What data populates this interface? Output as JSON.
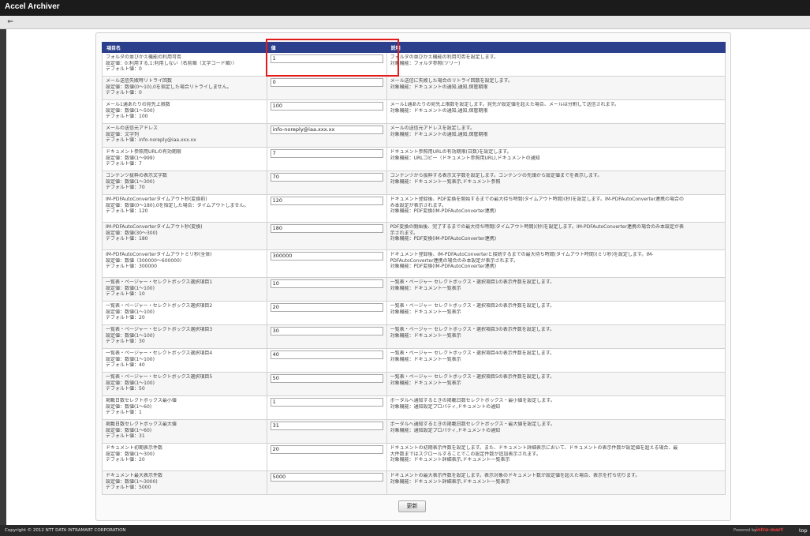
{
  "window": {
    "title": "Accel Archiver"
  },
  "toolbar": {
    "back_label": "⇐"
  },
  "table": {
    "headers": {
      "name": "項目名",
      "value": "値",
      "description": "説明"
    },
    "rows": [
      {
        "name": [
          "フォルダの並びかえ機能の利用可否",
          "設定値：0:利用する,1:利用しない（名前順（文字コード順））",
          "デフォルト値：0"
        ],
        "value": "1",
        "description": [
          "フォルダの並びかえ機能の利用可否を設定します。",
          "対象機能：フォルダ参照(ツリー)"
        ]
      },
      {
        "name": [
          "メール送信失敗時リトライ回数",
          "設定値：数値(0～10),0を指定した場合リトライしません。",
          "デフォルト値：0"
        ],
        "value": "0",
        "description": [
          "メール送信に失敗した場合のリトライ回数を設定します。",
          "対象機能：ドキュメントの通知,通知,保管期限"
        ]
      },
      {
        "name": [
          "メール1通あたりの宛先上限数",
          "設定値：数値(1～500)",
          "デフォルト値：100"
        ],
        "value": "100",
        "description": [
          "メール1通あたりの宛先上限数を設定します。宛先が設定値を超えた場合、メールは分割して送信されます。",
          "対象機能：ドキュメントの通知,通知,保管期限"
        ]
      },
      {
        "name": [
          "メールの送信元アドレス",
          "設定値：文字列",
          "デフォルト値：info-noreply@iaa.xxx.xx"
        ],
        "value": "info-noreply@iaa.xxx.xx",
        "description": [
          "メールの送信元アドレスを設定します。",
          "対象機能：ドキュメントの通知,通知,保管期限"
        ]
      },
      {
        "name": [
          "ドキュメント参照用URLの有効期限",
          "設定値：数値(1～999)",
          "デフォルト値：7"
        ],
        "value": "7",
        "description": [
          "ドキュメント参照用URLの有効期限(日数)を設定します。",
          "対象機能：URLコピー（ドキュメント参照用URL),ドキュメントの通知"
        ]
      },
      {
        "name": [
          "コンテンツ抜粋の表示文字数",
          "設定値：数値(1～300)",
          "デフォルト値：70"
        ],
        "value": "70",
        "description": [
          "コンテンツから抜粋する表示文字数を設定します。コンテンツの先頭から設定値までを表示します。",
          "対象機能：ドキュメント一覧表示,ドキュメント参照"
        ]
      },
      {
        "name": [
          "IM-PDFAutoConverterタイムアウト秒(変換前)",
          "設定値：数値(0～180),0を指定した場合：タイムアウトしません。",
          "デフォルト値：120"
        ],
        "value": "120",
        "description": [
          "ドキュメント登録後、PDF変換を開始するまでの最大待ち時間(タイムアウト時間)(秒)を設定します。IM-PDFAutoConverter連携の場合の",
          "み本設定が表示されます。",
          "対象機能：PDF変換(IM-PDFAutoConverter連携)"
        ],
        "tall": true
      },
      {
        "name": [
          "IM-PDFAutoConverterタイムアウト秒(変換)",
          "設定値：数値(30～300)",
          "デフォルト値：180"
        ],
        "value": "180",
        "description": [
          "PDF変換の開始後、完了するまでの最大待ち時間(タイムアウト時間)(秒)を設定します。IM-PDFAutoConverter連携の場合のみ本設定が表",
          "示されます。",
          "対象機能：PDF変換(IM-PDFAutoConverter連携)"
        ],
        "tall": true
      },
      {
        "name": [
          "IM-PDFAutoConverterタイムアウトミリ秒(全体)",
          "設定値：数値（300000～600000）",
          "デフォルト値：300000"
        ],
        "value": "300000",
        "description": [
          "ドキュメント登録後、IM-PDFAutoConverterと接続するまでの最大待ち時間(タイムアウト時間)(ミリ秒)を設定します。IM-",
          "PDFAutoConverter連携の場合のみ本設定が表示されます。",
          "対象機能：PDF変換(IM-PDFAutoConverter連携)"
        ],
        "tall": true
      },
      {
        "name": [
          "一覧表・ページャー・セレクトボックス選択項目1",
          "設定値：数値(1～100)",
          "デフォルト値：10"
        ],
        "value": "10",
        "description": [
          "一覧表・ページャー セレクトボックス・選択項目1の表示件数を設定します。",
          "対象機能：ドキュメント一覧表示"
        ]
      },
      {
        "name": [
          "一覧表・ページャー・セレクトボックス選択項目2",
          "設定値：数値(1～100)",
          "デフォルト値：20"
        ],
        "value": "20",
        "description": [
          "一覧表・ページャー セレクトボックス・選択項目2の表示件数を設定します。",
          "対象機能：ドキュメント一覧表示"
        ]
      },
      {
        "name": [
          "一覧表・ページャー・セレクトボックス選択項目3",
          "設定値：数値(1～100)",
          "デフォルト値：30"
        ],
        "value": "30",
        "description": [
          "一覧表・ページャー セレクトボックス・選択項目3の表示件数を設定します。",
          "対象機能：ドキュメント一覧表示"
        ]
      },
      {
        "name": [
          "一覧表・ページャー・セレクトボックス選択項目4",
          "設定値：数値(1～100)",
          "デフォルト値：40"
        ],
        "value": "40",
        "description": [
          "一覧表・ページャー セレクトボックス・選択項目4の表示件数を設定します。",
          "対象機能：ドキュメント一覧表示"
        ]
      },
      {
        "name": [
          "一覧表・ページャー・セレクトボックス選択項目5",
          "設定値：数値(1～100)",
          "デフォルト値：50"
        ],
        "value": "50",
        "description": [
          "一覧表・ページャー セレクトボックス・選択項目5の表示件数を設定します。",
          "対象機能：ドキュメント一覧表示"
        ]
      },
      {
        "name": [
          "掲載日数セレクトボックス最小値",
          "設定値：数値(1～60)",
          "デフォルト値：1"
        ],
        "value": "1",
        "description": [
          "ポータルへ通知するときの掲載日数セレクトボックス・最小値を設定します。",
          "対象機能：通知設定プロパティ,ドキュメントの通知"
        ]
      },
      {
        "name": [
          "掲載日数セレクトボックス最大値",
          "設定値：数値(1～60)",
          "デフォルト値：31"
        ],
        "value": "31",
        "description": [
          "ポータルへ通知するときの掲載日数セレクトボックス・最大値を設定します。",
          "対象機能：通知設定プロパティ,ドキュメントの通知"
        ]
      },
      {
        "name": [
          "ドキュメント初期表示件数",
          "設定値：数値(1～300)",
          "デフォルト値：20"
        ],
        "value": "20",
        "description": [
          "ドキュメントの初期表示件数を設定します。また、ドキュメント詳細表示において、ドキュメントの表示件数が設定値を超える場合、最",
          "大件数まではスクロールすることでこの設定件数が追加表示されます。",
          "対象機能：ドキュメント詳細表示,ドキュメント一覧表示"
        ],
        "tall": true
      },
      {
        "name": [
          "ドキュメント最大表示件数",
          "設定値：数値(1～3000)",
          "デフォルト値：5000"
        ],
        "value": "5000",
        "description": [
          "ドキュメントの最大表示件数を設定します。表示対象のドキュメント数が設定値を超えた場合、表示を打ち切ります。",
          "対象機能：ドキュメント詳細表示,ドキュメント一覧表示"
        ]
      }
    ]
  },
  "actions": {
    "update_label": "更新"
  },
  "footer": {
    "copyright": "Copyright © 2012 NTT DATA INTRAMART CORPORATION",
    "powered_by": "Powered by",
    "logo_text": "intra-mart",
    "top_label": "top"
  },
  "colors": {
    "header_bg": "#2b3f8c",
    "highlight": "#e31b1b",
    "titlebar": "#1b1b1b"
  }
}
